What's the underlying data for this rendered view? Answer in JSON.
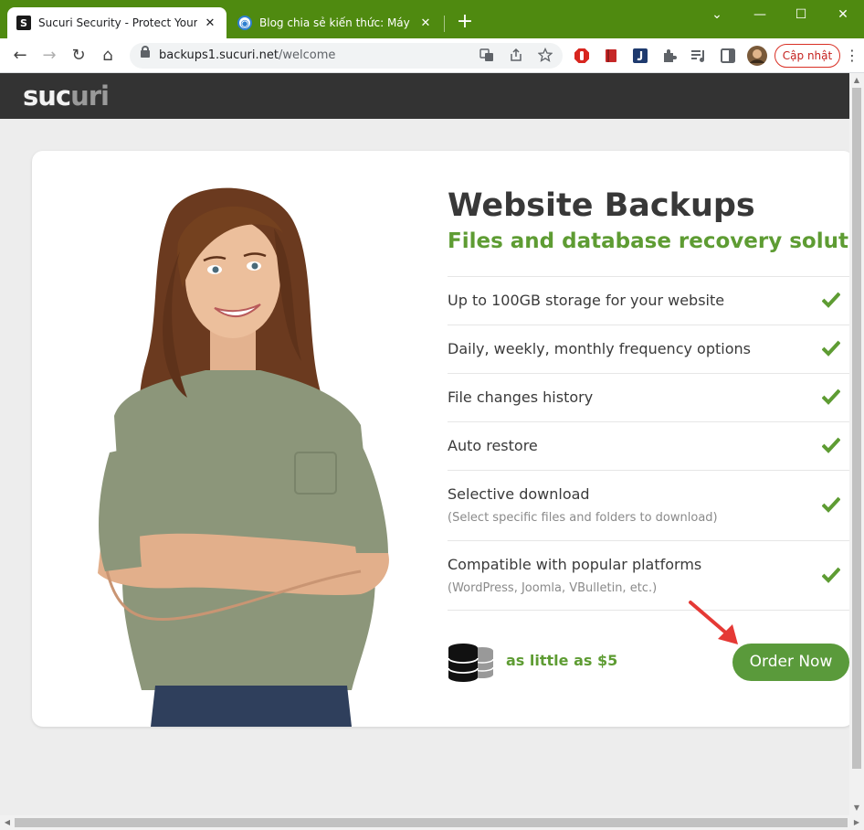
{
  "browser": {
    "tabs": [
      {
        "title": "Sucuri Security - Protect Your Inte",
        "favicon": "S",
        "close": "✕",
        "active": true
      },
      {
        "title": "Blog chia sẻ kiến thức: Máy tính",
        "favicon": "◉",
        "close": "✕",
        "active": false
      }
    ],
    "new_tab": "+",
    "window_controls": {
      "dropdown": "⌄",
      "minimize": "—",
      "maximize": "☐",
      "close": "✕"
    },
    "nav": {
      "back": "←",
      "forward": "→",
      "reload": "↻",
      "home": "⌂"
    },
    "url_host": "backups1.sucuri.net",
    "url_path": "/welcome",
    "update_label": "Cập nhật",
    "menu": "⋮"
  },
  "site": {
    "logo_main": "suc",
    "logo_dim": "uri"
  },
  "hero": {
    "title": "Website Backups",
    "subtitle": "Files and database recovery solution",
    "features": [
      {
        "text": "Up to 100GB storage for your website",
        "sub": ""
      },
      {
        "text": "Daily, weekly, monthly frequency options",
        "sub": ""
      },
      {
        "text": "File changes history",
        "sub": ""
      },
      {
        "text": "Auto restore",
        "sub": ""
      },
      {
        "text": "Selective download",
        "sub": "(Select specific files and folders to download)"
      },
      {
        "text": "Compatible with popular platforms",
        "sub": "(WordPress, Joomla, VBulletin, etc.)"
      }
    ],
    "price_label": "as little as $5",
    "order_label": "Order Now"
  },
  "colors": {
    "tab_bar": "#4f8a10",
    "header": "#333333",
    "accent_green": "#5e9c33",
    "button_green": "#5a9a3b",
    "arrow_red": "#e53935"
  },
  "icons": {
    "check": "check-icon",
    "database": "database-icon",
    "arrow": "red-arrow-annotation"
  }
}
